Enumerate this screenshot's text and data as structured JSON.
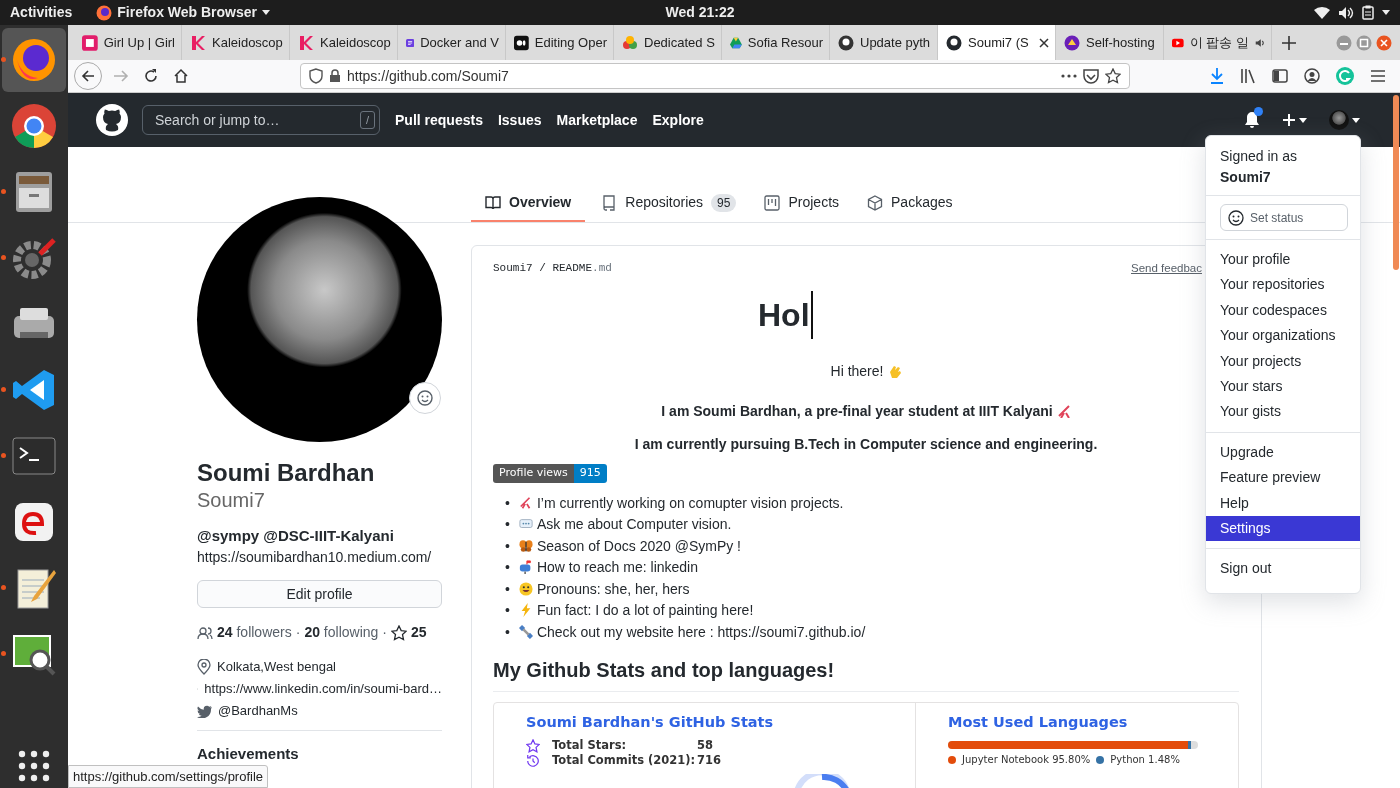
{
  "system_bar": {
    "activities": "Activities",
    "app_menu": "Firefox Web Browser",
    "clock": "Wed 21:22"
  },
  "dock": {
    "apps": [
      {
        "running": true,
        "selected": true
      },
      {
        "running": false,
        "selected": false
      },
      {
        "running": true,
        "selected": false
      },
      {
        "running": true,
        "selected": false
      },
      {
        "running": false,
        "selected": false
      },
      {
        "running": true,
        "selected": false
      },
      {
        "running": true,
        "selected": false
      },
      {
        "running": false,
        "selected": false
      },
      {
        "running": true,
        "selected": false
      },
      {
        "running": true,
        "selected": false
      }
    ]
  },
  "browser": {
    "tabs": [
      {
        "title": "Girl Up | Girl",
        "selected": false,
        "audio": false
      },
      {
        "title": "Kaleidoscop",
        "selected": false,
        "audio": false
      },
      {
        "title": "Kaleidoscop",
        "selected": false,
        "audio": false
      },
      {
        "title": "Docker and V",
        "selected": false,
        "audio": false
      },
      {
        "title": "Editing Oper",
        "selected": false,
        "audio": false
      },
      {
        "title": "Dedicated S",
        "selected": false,
        "audio": false
      },
      {
        "title": "Sofia Resour",
        "selected": false,
        "audio": false
      },
      {
        "title": "Update pyth",
        "selected": false,
        "audio": false
      },
      {
        "title": "Soumi7 (S",
        "selected": true,
        "audio": false
      },
      {
        "title": "Self-hosting",
        "selected": false,
        "audio": false
      },
      {
        "title": "이 팝송 일",
        "selected": false,
        "audio": true
      }
    ],
    "forward_disabled": true,
    "url": "https://github.com/Soumi7",
    "status_link": "https://github.com/settings/profile"
  },
  "github": {
    "search_placeholder": "Search or jump to…",
    "search_key": "/",
    "nav": [
      "Pull requests",
      "Issues",
      "Marketplace",
      "Explore"
    ],
    "notification_unread": true
  },
  "profile_tabs": [
    {
      "label": "Overview",
      "selected": true
    },
    {
      "label": "Repositories",
      "count": "95",
      "selected": false
    },
    {
      "label": "Projects",
      "selected": false
    },
    {
      "label": "Packages",
      "selected": false
    }
  ],
  "profile": {
    "name": "Soumi Bardhan",
    "login": "Soumi7",
    "bio": "@sympy @DSC-IIIT-Kalyani",
    "website": "https://soumibardhan10.medium.com/",
    "edit_button": "Edit profile",
    "followers": "24",
    "followers_label": "followers",
    "following": "20",
    "following_label": "following",
    "starred_count": "25",
    "separator": "·",
    "location": "Kolkata,West bengal",
    "linkedin": "https://www.linkedin.com/in/soumi-bard…",
    "twitter": "@BardhanMs",
    "achievements": "Achievements"
  },
  "readme": {
    "owner": "Soumi7",
    "separator": "/",
    "file": "README",
    "ext": ".md",
    "feedback": "Send feedbac",
    "typing": "Hol",
    "greeting": "Hi there!",
    "intro": "I am Soumi Bardhan, a pre-final year student at IIIT Kalyani",
    "study": "I am currently pursuing B.Tech in Computer science and engineering.",
    "views_label": "Profile views",
    "views": "915",
    "bullets": [
      {
        "bullet": "•",
        "text": "I’m currently working on comupter vision projects."
      },
      {
        "bullet": "•",
        "text": "Ask me about Computer vision."
      },
      {
        "bullet": "•",
        "text": "Season of Docs 2020 @SymPy !"
      },
      {
        "bullet": "•",
        "text": "How to reach me: ",
        "link": "linkedin"
      },
      {
        "bullet": "•",
        "text": "Pronouns: she, her, hers"
      },
      {
        "bullet": "•",
        "text": "Fun fact: I do a lot of painting ",
        "link": "here",
        "after": "!"
      },
      {
        "bullet": "•",
        "text": "Check out my website here : ",
        "link": "https://soumi7.github.io/"
      }
    ],
    "stats_heading": "My Github Stats and top languages!",
    "stats_card": {
      "title": "Soumi Bardhan's GitHub Stats",
      "rows": [
        {
          "label": "Total Stars:",
          "value": "58"
        },
        {
          "label": "Total Commits (2021):",
          "value": "716"
        }
      ]
    },
    "languages_card": {
      "title": "Most Used Languages",
      "languages": [
        {
          "name": "Jupyter Notebook",
          "percent": "95.80%",
          "color": "#e34c0b",
          "level": 0.958
        },
        {
          "name": "Python",
          "percent": "1.48%",
          "color": "#3572a5",
          "level": 0.0148
        }
      ]
    }
  },
  "account_menu": {
    "signed_in": "Signed in as **Soumi7**",
    "set_status": "Set status",
    "sections": [
      {
        "items": [
          {
            "label": "Your profile",
            "selected": false
          },
          {
            "label": "Your repositories",
            "selected": false
          },
          {
            "label": "Your codespaces",
            "selected": false
          },
          {
            "label": "Your organizations",
            "selected": false
          },
          {
            "label": "Your projects",
            "selected": false
          },
          {
            "label": "Your stars",
            "selected": false
          },
          {
            "label": "Your gists",
            "selected": false
          }
        ]
      },
      {
        "items": [
          {
            "label": "Upgrade",
            "selected": false
          },
          {
            "label": "Feature preview",
            "selected": false
          },
          {
            "label": "Help",
            "selected": false
          },
          {
            "label": "Settings",
            "selected": true
          }
        ]
      },
      {
        "items": [
          {
            "label": "Sign out",
            "selected": false
          }
        ]
      }
    ]
  }
}
